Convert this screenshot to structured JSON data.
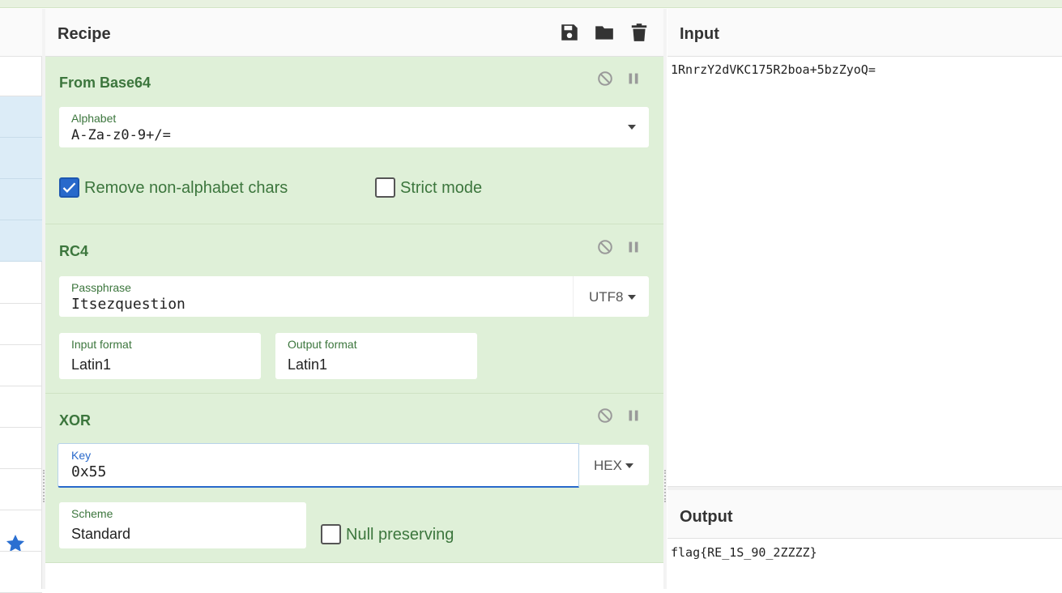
{
  "recipe": {
    "title": "Recipe",
    "icons": [
      "save-icon",
      "folder-icon",
      "trash-icon"
    ]
  },
  "ops": [
    {
      "title": "From Base64",
      "alphabet_label": "Alphabet",
      "alphabet_value": "A-Za-z0-9+/=",
      "remove_label": "Remove non-alphabet chars",
      "remove_checked": true,
      "strict_label": "Strict mode",
      "strict_checked": false
    },
    {
      "title": "RC4",
      "passphrase_label": "Passphrase",
      "passphrase_value": "Itsezquestion",
      "passphrase_encoding": "UTF8",
      "input_format_label": "Input format",
      "input_format_value": "Latin1",
      "output_format_label": "Output format",
      "output_format_value": "Latin1"
    },
    {
      "title": "XOR",
      "key_label": "Key",
      "key_value": "0x55",
      "key_encoding": "HEX",
      "scheme_label": "Scheme",
      "scheme_value": "Standard",
      "null_label": "Null preserving",
      "null_checked": false
    }
  ],
  "input": {
    "title": "Input",
    "text": "1RnrzY2dVKC175R2boa+5bzZyoQ="
  },
  "output": {
    "title": "Output",
    "text": "flag{RE_1S_90_2ZZZZ}"
  },
  "colors": {
    "op_bg": "#dff0d8",
    "op_title": "#3c763d",
    "accent": "#2869cb"
  }
}
